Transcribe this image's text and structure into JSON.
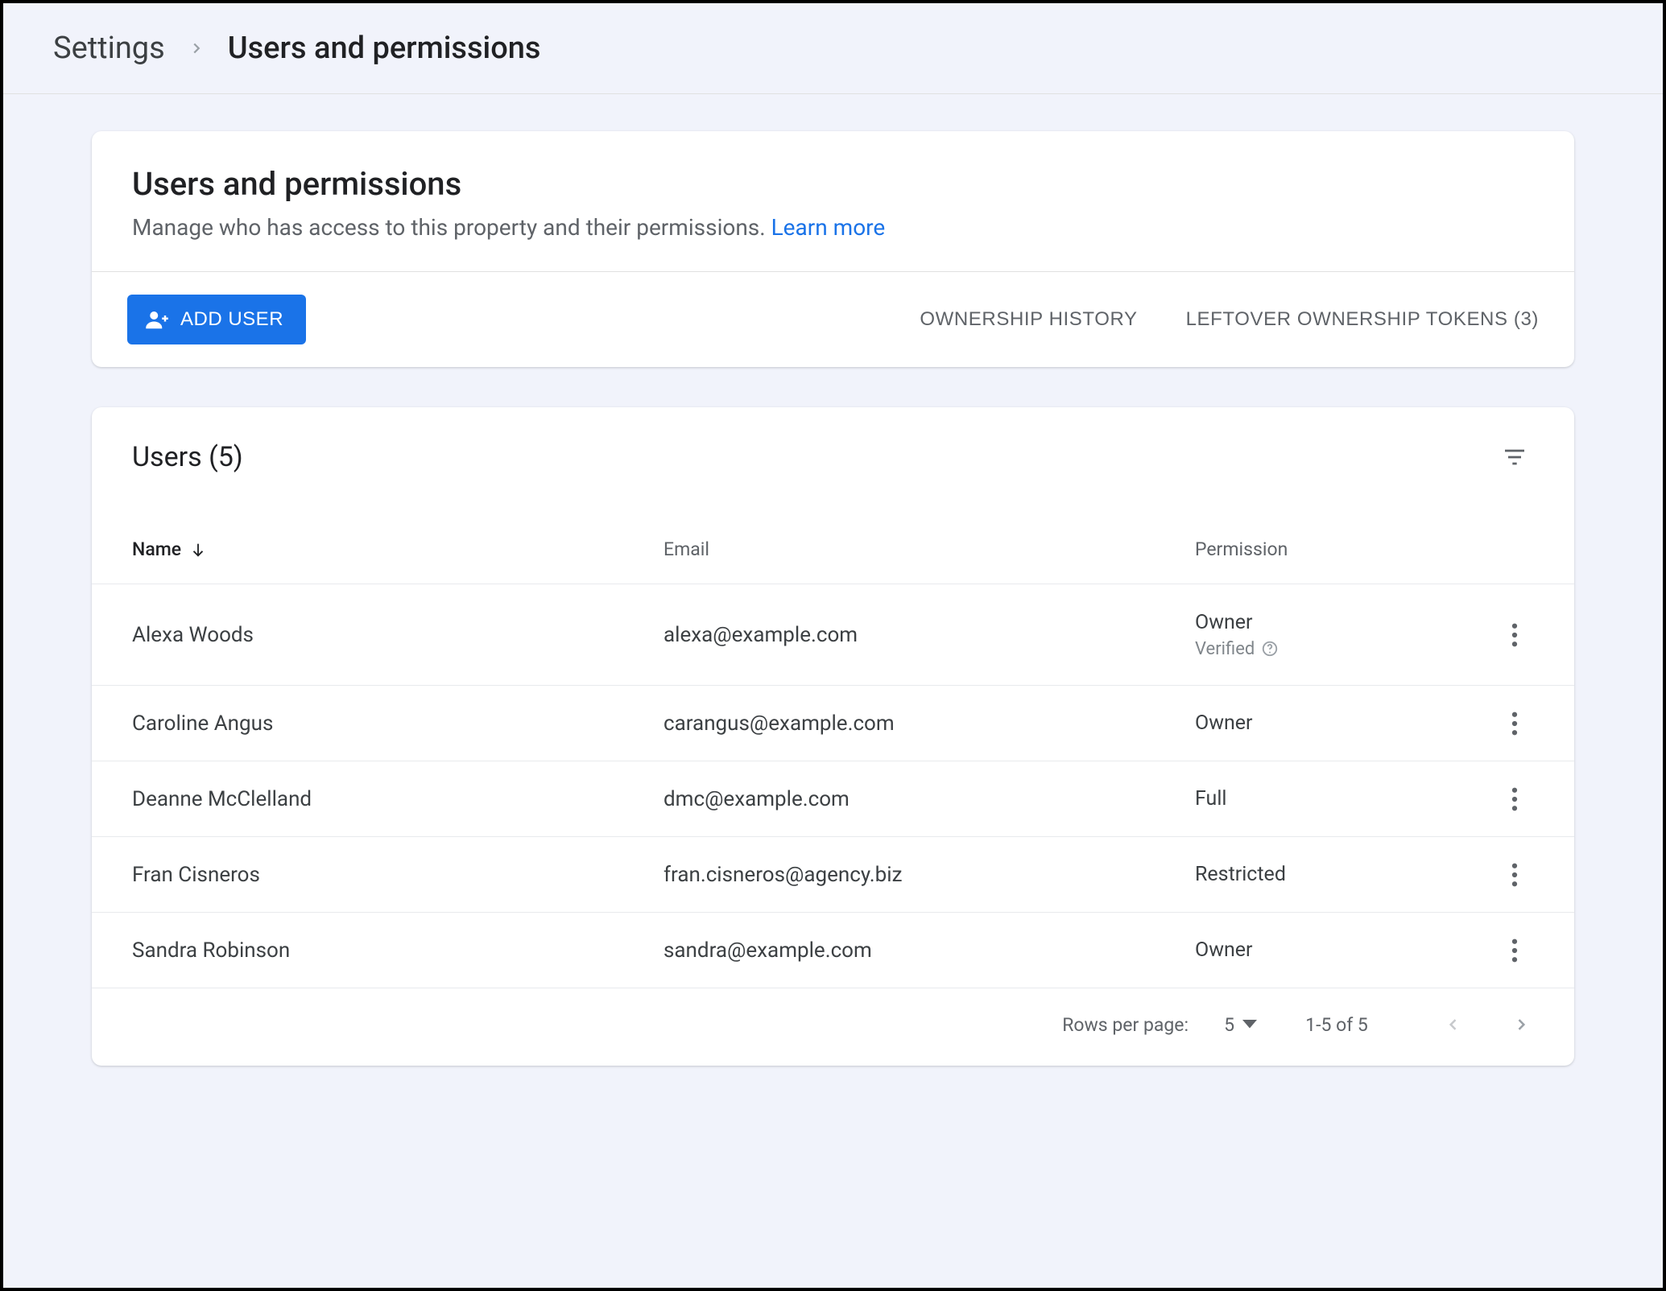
{
  "breadcrumb": {
    "root": "Settings",
    "current": "Users and permissions"
  },
  "header_card": {
    "title": "Users and permissions",
    "description": "Manage who has access to this property and their permissions.",
    "learn_more": "Learn more",
    "add_user_label": "ADD USER",
    "ownership_history_label": "OWNERSHIP HISTORY",
    "leftover_tokens_label": "LEFTOVER OWNERSHIP TOKENS (3)"
  },
  "users_card": {
    "title": "Users (5)",
    "columns": {
      "name": "Name",
      "email": "Email",
      "permission": "Permission"
    },
    "rows": [
      {
        "name": "Alexa Woods",
        "email": "alexa@example.com",
        "permission": "Owner",
        "verified": "Verified"
      },
      {
        "name": "Caroline Angus",
        "email": "carangus@example.com",
        "permission": "Owner"
      },
      {
        "name": "Deanne McClelland",
        "email": "dmc@example.com",
        "permission": "Full"
      },
      {
        "name": "Fran Cisneros",
        "email": "fran.cisneros@agency.biz",
        "permission": "Restricted"
      },
      {
        "name": "Sandra Robinson",
        "email": "sandra@example.com",
        "permission": "Owner"
      }
    ],
    "pager": {
      "rows_per_page_label": "Rows per page:",
      "rows_per_page_value": "5",
      "range": "1-5 of 5"
    }
  }
}
